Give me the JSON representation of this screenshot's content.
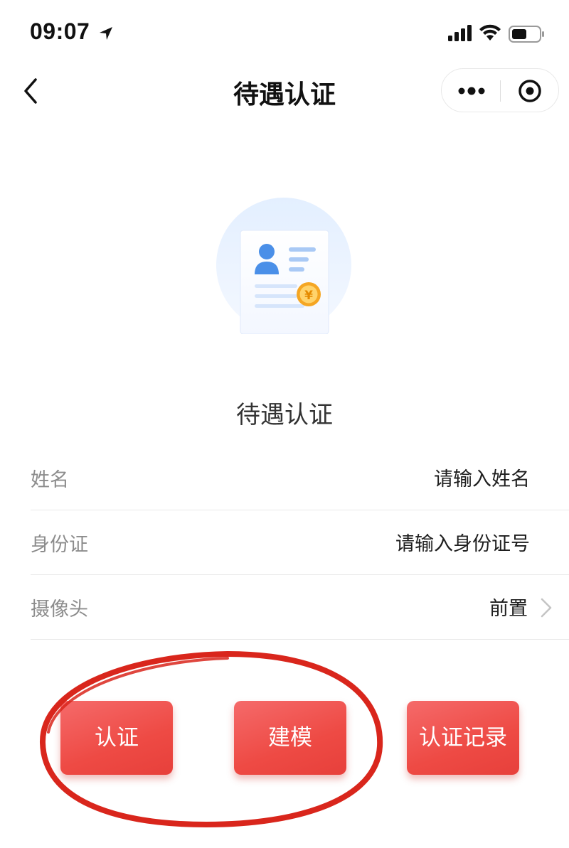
{
  "status_bar": {
    "time": "09:07"
  },
  "nav": {
    "title": "待遇认证"
  },
  "main": {
    "section_title": "待遇认证",
    "form": [
      {
        "label": "姓名",
        "value": "请输入姓名"
      },
      {
        "label": "身份证",
        "value": "请输入身份证号"
      },
      {
        "label": "摄像头",
        "value": "前置"
      }
    ]
  },
  "buttons": {
    "auth": "认证",
    "model": "建模",
    "record": "认证记录"
  },
  "colors": {
    "accent_red": "#ee4a44",
    "annotation_red": "#d9261c",
    "illustration_blue": "#4a8fe8",
    "coin_orange": "#f5a623"
  },
  "icons": [
    "location-arrow-icon",
    "signal-icon",
    "wifi-icon",
    "battery-icon",
    "back-chevron-icon",
    "more-dots-icon",
    "target-circle-icon",
    "id-card-illustration",
    "chevron-right-icon"
  ]
}
